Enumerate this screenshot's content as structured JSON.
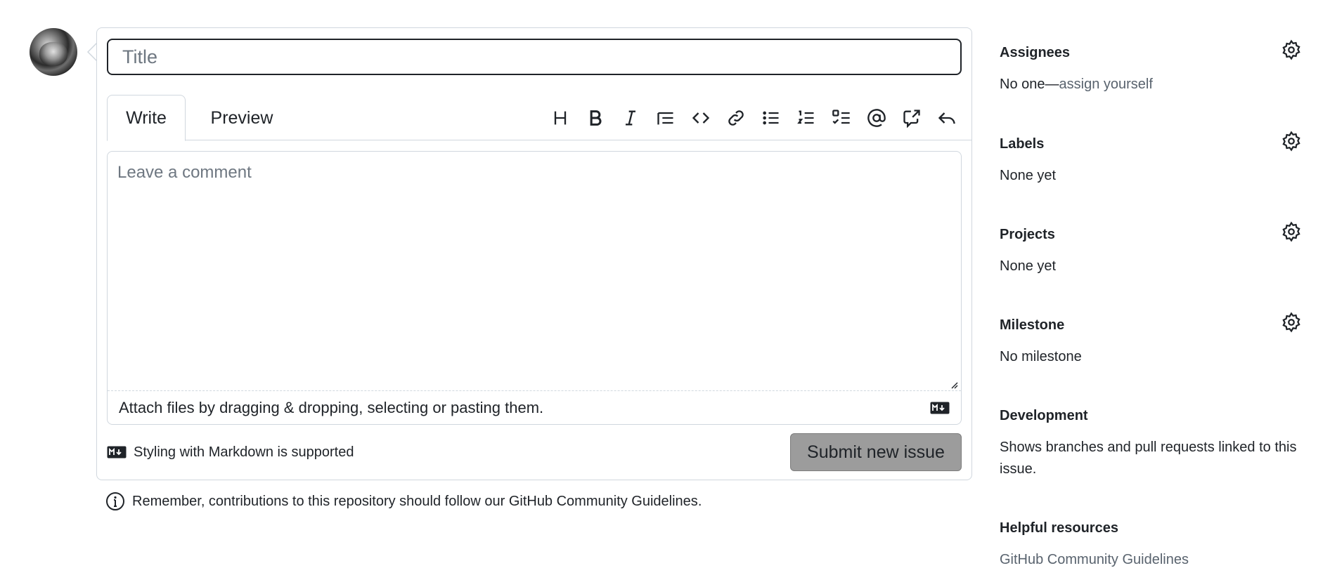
{
  "composer": {
    "title_placeholder": "Title",
    "title_value": "",
    "tabs": {
      "write": "Write",
      "preview": "Preview"
    },
    "toolbar_icons": [
      "heading-icon",
      "bold-icon",
      "italic-icon",
      "quote-icon",
      "code-icon",
      "link-icon",
      "bulleted-list-icon",
      "numbered-list-icon",
      "task-list-icon",
      "mention-icon",
      "cross-reference-icon",
      "reply-icon"
    ],
    "comment_placeholder": "Leave a comment",
    "attach_text": "Attach files by dragging & dropping, selecting or pasting them.",
    "markdown_note": "Styling with Markdown is supported",
    "submit_label": "Submit new issue"
  },
  "reminder": {
    "text_prefix": "Remember, contributions to this repository should follow our ",
    "link": "GitHub Community Guidelines",
    "text_suffix": "."
  },
  "sidebar": {
    "assignees": {
      "heading": "Assignees",
      "value_prefix": "No one—",
      "value_link": "assign yourself"
    },
    "labels": {
      "heading": "Labels",
      "value": "None yet"
    },
    "projects": {
      "heading": "Projects",
      "value": "None yet"
    },
    "milestone": {
      "heading": "Milestone",
      "value": "No milestone"
    },
    "development": {
      "heading": "Development",
      "value": "Shows branches and pull requests linked to this issue."
    },
    "helpful": {
      "heading": "Helpful resources",
      "link": "GitHub Community Guidelines"
    }
  },
  "colors": {
    "text": "#1f2328",
    "border": "#d0d7de",
    "muted": "#59636e",
    "submit_bg": "#9c9c9c"
  }
}
